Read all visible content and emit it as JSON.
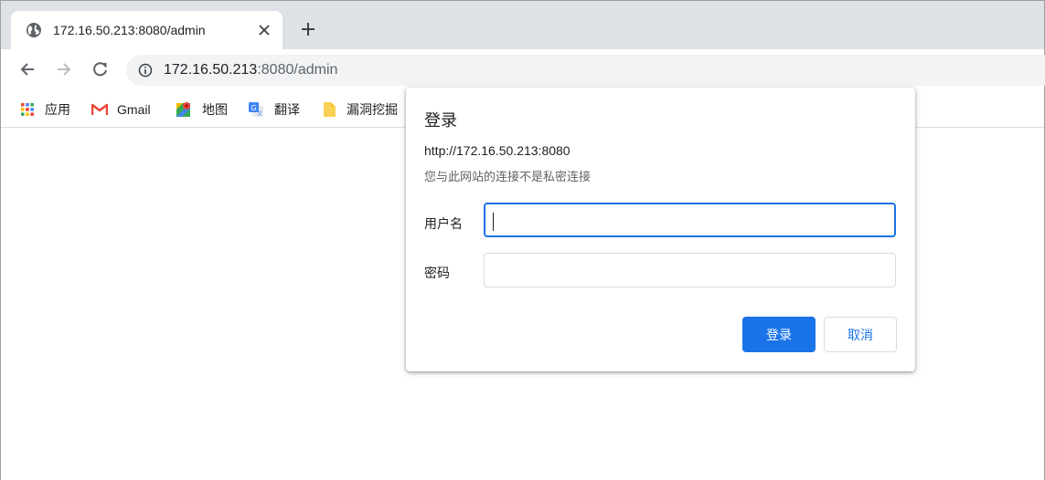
{
  "browser": {
    "tab": {
      "title": "172.16.50.213:8080/admin",
      "icon": "globe-icon",
      "close_icon": "close-icon"
    },
    "new_tab_icon": "plus-icon",
    "nav": {
      "back_icon": "back-arrow-icon",
      "forward_icon": "forward-arrow-icon",
      "reload_icon": "reload-icon"
    },
    "omnibox": {
      "icon": "info-icon",
      "host": "172.16.50.213",
      "path": ":8080/admin"
    },
    "bookmarks": [
      {
        "label": "应用",
        "icon": "apps-grid-icon"
      },
      {
        "label": "Gmail",
        "icon": "gmail-icon"
      },
      {
        "label": "地图",
        "icon": "maps-icon"
      },
      {
        "label": "翻译",
        "icon": "translate-icon"
      },
      {
        "label": "漏洞挖掘",
        "icon": "folder-icon"
      }
    ]
  },
  "dialog": {
    "title": "登录",
    "origin": "http://172.16.50.213:8080",
    "warning": "您与此网站的连接不是私密连接",
    "username_label": "用户名",
    "username_value": "",
    "password_label": "密码",
    "password_value": "",
    "submit_label": "登录",
    "cancel_label": "取消"
  },
  "colors": {
    "accent": "#1a73e8",
    "tabstrip": "#dee1e6",
    "omnibox": "#f1f3f4"
  }
}
